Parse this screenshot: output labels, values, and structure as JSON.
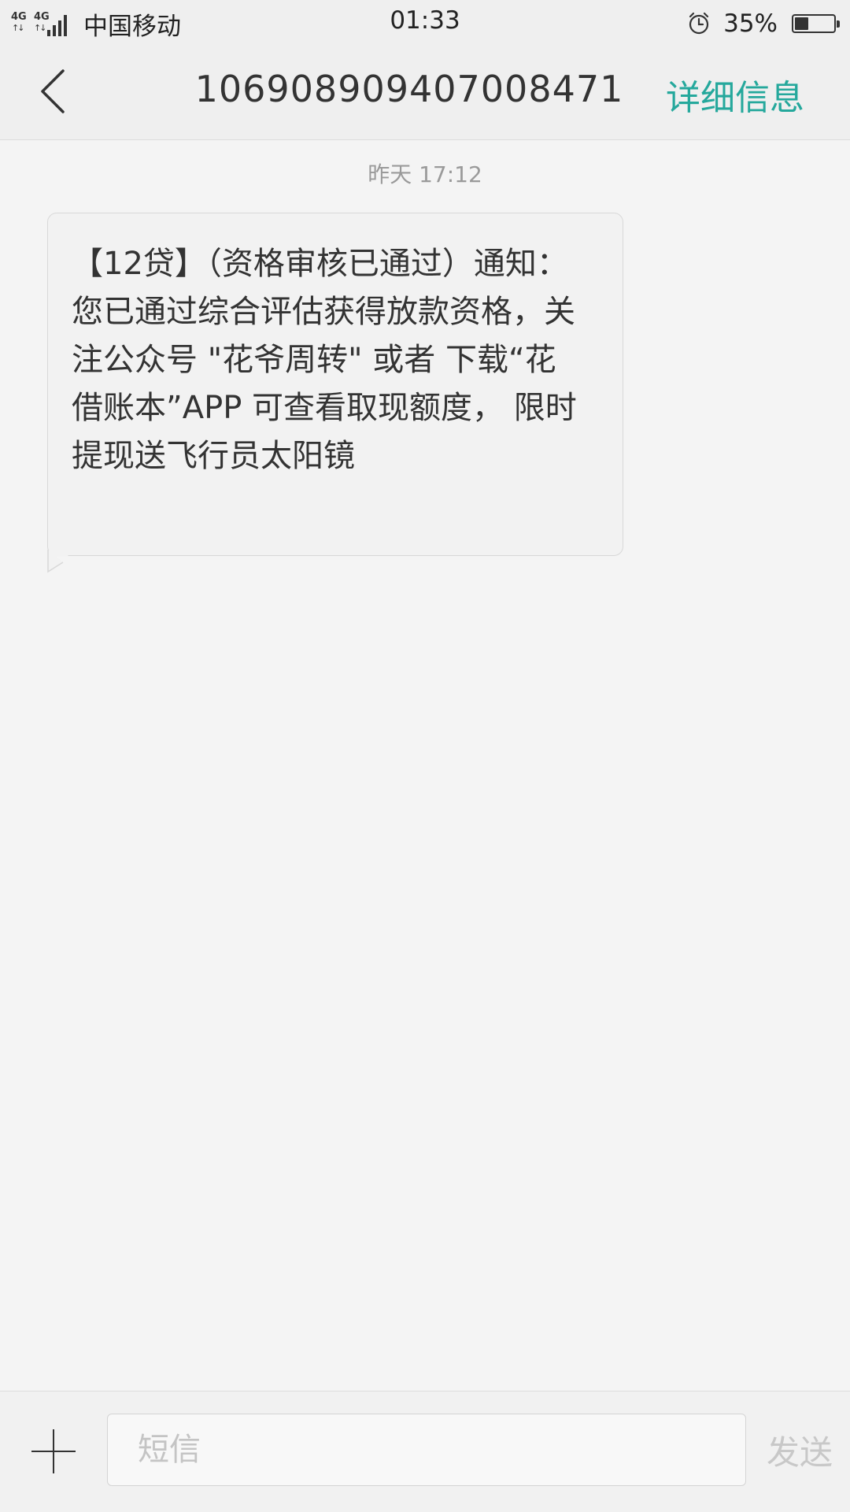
{
  "status_bar": {
    "network_1": "4G",
    "network_2": "4G",
    "carrier": "中国移动",
    "time": "01:33",
    "battery_percent": "35%",
    "battery_level": 0.35,
    "icons": {
      "signal": "signal-bars-icon",
      "alarm": "alarm-clock-icon",
      "battery": "battery-icon"
    }
  },
  "header": {
    "back_icon": "chevron-left-icon",
    "contact_number": "1069089094070084​71",
    "details_label": "详细信息",
    "accent_color": "#25a89c"
  },
  "conversation": {
    "messages": [
      {
        "timestamp": "昨天  17:12",
        "direction": "incoming",
        "text": "【12贷】（资格审核已通过）通知：您已通过综合评估获得放款资格，关注公众号 \"花爷周转\" 或者 下载“花借账本”APP 可查看取现额度， 限时提现送飞行员太阳镜"
      }
    ]
  },
  "composer": {
    "attach_icon": "plus-icon",
    "input_value": "",
    "input_placeholder": "短信",
    "send_label": "发送"
  }
}
